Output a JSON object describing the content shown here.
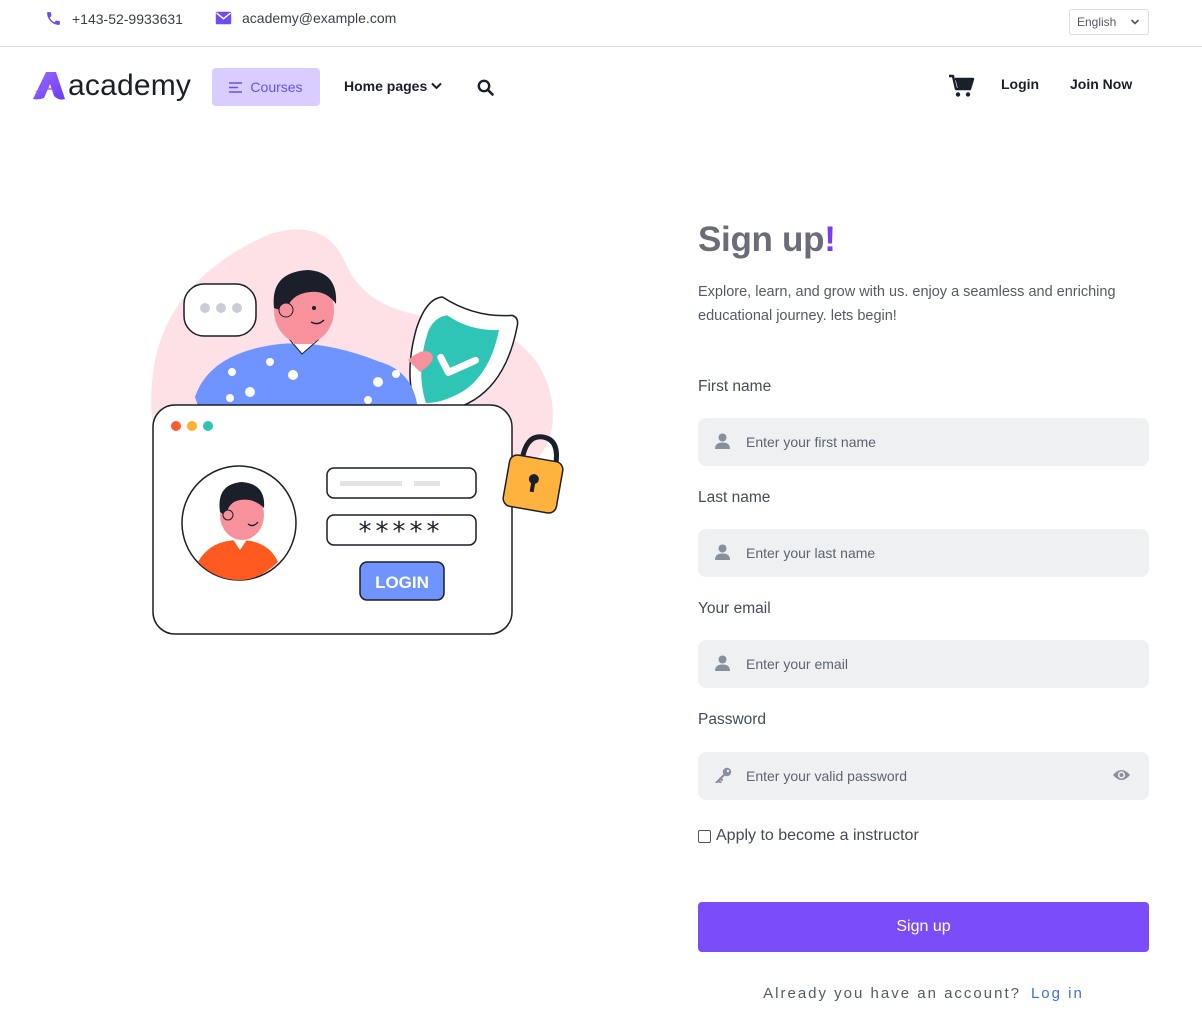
{
  "topbar": {
    "phone": "+143-52-9933631",
    "email": "academy@example.com",
    "language": "English"
  },
  "navbar": {
    "logo_text": "academy",
    "courses_label": "Courses",
    "home_pages_label": "Home pages",
    "login_label": "Login",
    "join_label": "Join Now"
  },
  "illustration": {
    "password_mask": "*****",
    "login_label": "LOGIN"
  },
  "form": {
    "title": "Sign up",
    "title_mark": "!",
    "subtitle": "Explore, learn, and grow with us. enjoy a seamless and enriching educational journey. lets begin!",
    "first_name_label": "First name",
    "first_name_placeholder": "Enter your first name",
    "last_name_label": "Last name",
    "last_name_placeholder": "Enter your last name",
    "email_label": "Your email",
    "email_placeholder": "Enter your email",
    "password_label": "Password",
    "password_placeholder": "Enter your valid password",
    "instructor_checkbox_label": "Apply to become a instructor",
    "submit_label": "Sign up",
    "account_prompt": "Already you have an account?",
    "login_link": "Log in"
  },
  "colors": {
    "accent": "#7b4dfa",
    "courses_bg": "#d9ccff",
    "field_bg": "#eff0f2",
    "link": "#3d6fe0"
  }
}
